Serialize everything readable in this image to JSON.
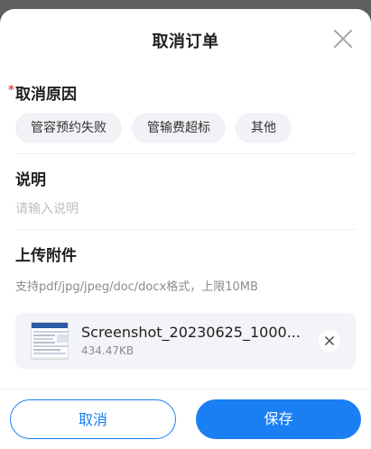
{
  "dialog": {
    "title": "取消订单",
    "close_icon": "close-icon"
  },
  "reason": {
    "label": "取消原因",
    "required_mark": "*",
    "options": [
      "管容预约失败",
      "管输费超标",
      "其他"
    ]
  },
  "description": {
    "label": "说明",
    "placeholder": "请输入说明",
    "value": ""
  },
  "attachment": {
    "label": "上传附件",
    "hint": "支持pdf/jpg/jpeg/doc/docx格式，上限10MB",
    "file": {
      "name": "Screenshot_20230625_1000...",
      "size": "434.47KB",
      "thumbnail_icon": "screenshot-thumbnail",
      "remove_icon": "close-icon"
    }
  },
  "footer": {
    "cancel_label": "取消",
    "save_label": "保存"
  },
  "colors": {
    "primary": "#1a7ff2",
    "required": "#e54545",
    "chip_bg": "#f0f2f5",
    "card_bg": "#f3f4f7"
  }
}
